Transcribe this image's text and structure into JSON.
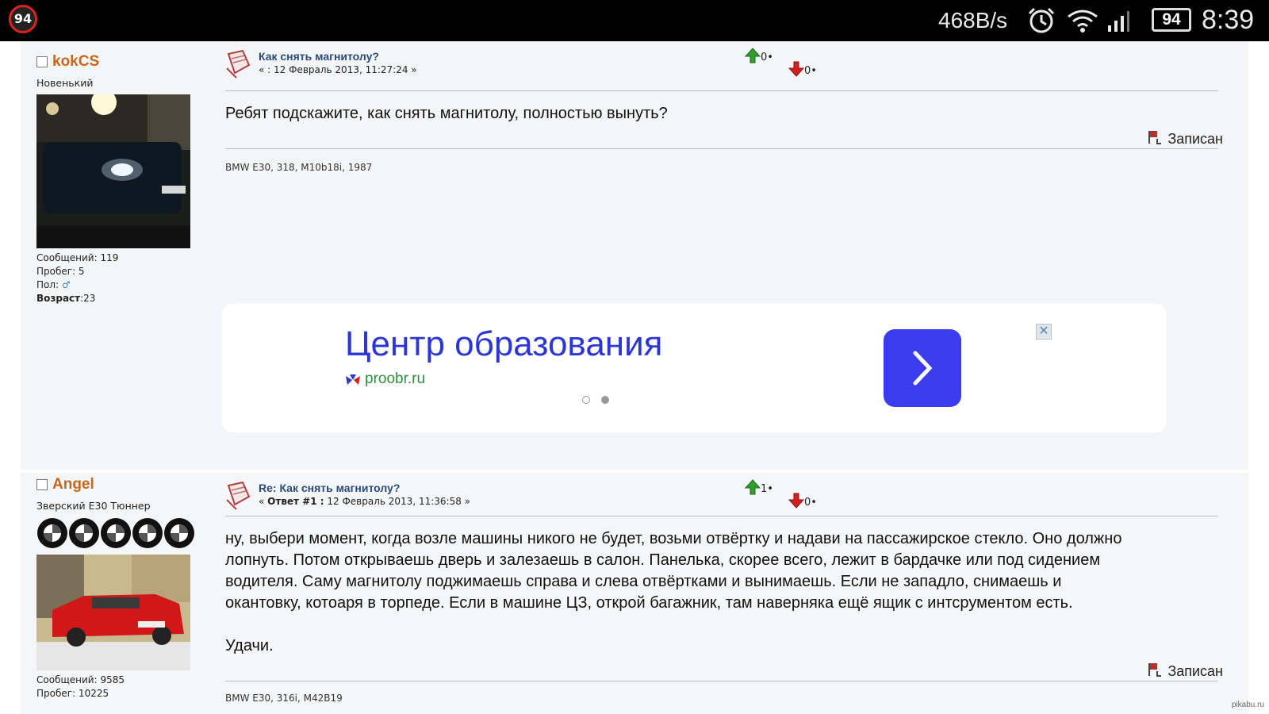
{
  "status_bar": {
    "notification_badge": "94",
    "net_speed": "468B/s",
    "battery": "94",
    "clock": "8:39",
    "icons": [
      "alarm-icon",
      "wifi-icon",
      "signal-icon"
    ]
  },
  "posts": [
    {
      "username": "kokCS",
      "rank": "Новенький",
      "stats": {
        "messages": "Сообщений: 119",
        "mileage": "Пробег: 5",
        "gender_label": "Пол:",
        "age_label": "Возраст",
        "age_value": ":23"
      },
      "title": "Как снять магнитолу?",
      "date_prefix": "« : ",
      "date": "12 Февраль 2013, 11:27:24 »",
      "votes_up": "0",
      "votes_down": "0",
      "text": "Ребят подскажите, как снять магнитолу, полностью вынуть?",
      "recorded": "Записан",
      "signature": "BMW E30, 318, M10b18i, 1987"
    },
    {
      "username": "Angel",
      "rank": "Зверский Е30 Тюннер",
      "stats": {
        "messages": "Сообщений: 9585",
        "mileage": "Пробег: 10225"
      },
      "title": "Re: Как снять магнитолу?",
      "date_prefix": "« ",
      "reply_label": "Ответ #1 :",
      "date": " 12 Февраль 2013, 11:36:58 »",
      "votes_up": "1",
      "votes_down": "0",
      "text_lines": [
        "ну, выбери момент, когда возле машины никого не будет, возьми отвёртку и надави на пассажирское стекло. Оно должно",
        "лопнуть. Потом открываешь дверь и залезаешь в салон. Панелька, скорее всего, лежит в бардачке или под сидением",
        "водителя. Саму магнитолу поджимаешь справа и слева отвёртками и вынимаешь. Если не западло, снимаешь и",
        "окантовку, котоаря в торпеде. Если в машине ЦЗ, открой багажник, там наверняка ещё ящик с интсрументом есть."
      ],
      "text_closing": "Удачи.",
      "recorded": "Записан",
      "signature": "BMW E30, 316i, M42B19"
    }
  ],
  "ad": {
    "title": "Центр образования",
    "domain": "proobr.ru",
    "colors": {
      "title": "#2c35d6",
      "domain": "#2f8f3a",
      "button": "#3b3cf0"
    }
  },
  "watermark": "pikabu.ru"
}
